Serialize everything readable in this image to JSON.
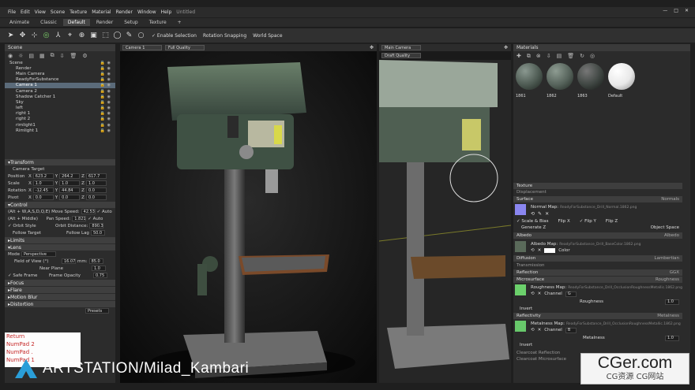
{
  "app": {
    "menu": [
      "File",
      "Edit",
      "View",
      "Scene",
      "Texture",
      "Material",
      "Render",
      "Window",
      "Help"
    ],
    "doc_title": "Untitled",
    "window_controls": [
      "—",
      "□",
      "✕"
    ]
  },
  "workspace_tabs": [
    "Animate",
    "Classic",
    "Default",
    "Render",
    "Setup",
    "Texture",
    "+"
  ],
  "workspace_active": "Default",
  "toolbar": {
    "enable_selection": "✓ Enable Selection",
    "rotation_snapping": "Rotation Snapping",
    "world_space": "World Space"
  },
  "scene": {
    "title": "Scene",
    "items": [
      "Scene",
      "Render",
      "Main Camera",
      "ReadyForSubstance",
      "Camera 1",
      "Camera 2",
      "Shadow Catcher 1",
      "Sky",
      "left",
      "right 1",
      "right 2",
      "rimlight1",
      "Rimlight 1"
    ],
    "selected": "Camera 1"
  },
  "transform": {
    "header": "Transform",
    "target_label": "Camera Target",
    "position": {
      "label": "Position",
      "x": "623.2",
      "y": "264.2",
      "z": "617.7"
    },
    "scale": {
      "label": "Scale",
      "x": "1.0",
      "y": "1.0",
      "z": "1.0"
    },
    "rotation": {
      "label": "Rotation",
      "x": "-12.45",
      "y": "44.84",
      "z": "0.0"
    },
    "pivot": {
      "label": "Pivot",
      "x": "0.0",
      "y": "0.0",
      "z": "0.0"
    }
  },
  "control": {
    "header": "Control",
    "move_speed_label": "(Alt + W,A,S,D,Q,E) Move Speed:",
    "move_speed": "42.53",
    "auto1": "✓ Auto",
    "pan_label": "(Alt + Middle)      Pan Speed:",
    "pan_speed": "1.821",
    "auto2": "✓ Auto",
    "orbit_style": "✓ Orbit Style",
    "orbit_distance_label": "Orbit Distance:",
    "orbit_distance": "890.3",
    "follow_target": "Follow Target",
    "follow_lag_label": "Follow Lag",
    "follow_lag": "50.0"
  },
  "lens": {
    "limits": "Limits",
    "lens": "Lens",
    "mode_label": "Mode",
    "mode_value": "Perspective",
    "fov_label": "Field of View (°)",
    "fov": "16.07",
    "mm_label": "mm:",
    "mm": "85.0",
    "near_plane_label": "Near Plane",
    "near_plane": "1.0",
    "safe_frame": "✓ Safe Frame",
    "frame_opacity_label": "Frame Opacity",
    "frame_opacity": "0.75"
  },
  "collapsed": [
    "Focus",
    "Flare",
    "Motion Blur",
    "Distortion"
  ],
  "presets": "Presets",
  "viewport1": {
    "camera": "Camera 1",
    "quality": "Full Quality"
  },
  "viewport2": {
    "camera": "Main Camera",
    "quality": "Draft Quality"
  },
  "materials": {
    "title": "Materials",
    "swatches": [
      {
        "name": "1861",
        "color": "#4d5a52"
      },
      {
        "name": "1862",
        "color": "#55625a"
      },
      {
        "name": "1863",
        "color": "#3e4541"
      },
      {
        "name": "Default",
        "color": "#e8e8e8"
      }
    ],
    "texture": "Texture",
    "displacement": "Displacement",
    "surface": {
      "label": "Surface",
      "value": "Normals"
    },
    "normal_map": "Normal Map:",
    "normal_file": "ReadyForSubstance_Drill_Normal.1862.png",
    "scale_bias": "✓ Scale & Bias",
    "flip_x": "Flip X",
    "flip_y": "✓ Flip Y",
    "flip_z": "Flip Z",
    "generate_z": "Generate Z",
    "object_space": "Object Space",
    "albedo": {
      "label": "Albedo",
      "value": "Albedo"
    },
    "albedo_map": "Albedo Map:",
    "albedo_file": "ReadyForSubstance_Drill_BaseColor.1862.png",
    "color_label": "Color",
    "diffusion": {
      "label": "Diffusion",
      "value": "Lambertian"
    },
    "transmission": "Transmission",
    "reflection": {
      "label": "Reflection",
      "value": "GGX"
    },
    "microsurface": {
      "label": "Microsurface",
      "value": "Roughness"
    },
    "roughness_map": "Roughness Map:",
    "roughness_file": "ReadyForSubstance_Drill_OcclusionRoughnessMetallic.1862.png",
    "channel_label": "Channel",
    "channel_g": "G",
    "roughness_label": "Roughness",
    "roughness_value": "1.0",
    "invert": "Invert",
    "reflectivity": {
      "label": "Reflectivity",
      "value": "Metalness"
    },
    "metalness_map": "Metalness Map:",
    "metalness_file": "ReadyForSubstance_Drill_OcclusionRoughnessMetallic.1862.png",
    "channel_b": "B",
    "metalness_label": "Metalness",
    "metalness_value": "1.0",
    "invert2": "Invert",
    "clearcoat_reflection": "Clearcoat Reflection",
    "clearcoat_microsurface": "Clearcoat Microsurface"
  },
  "overlay_keys": [
    "Return",
    "NumPad 2",
    "NumPad .",
    "NumPad 1"
  ],
  "artstation": "ARTSTATION/Milad_Kambari",
  "watermark": {
    "main": "CGer.com",
    "sub": "CG资源 CG网站"
  },
  "colors": {
    "accent": "#5b6b7a",
    "key_red": "#c62828",
    "drill_green": "#4a5f4c"
  }
}
